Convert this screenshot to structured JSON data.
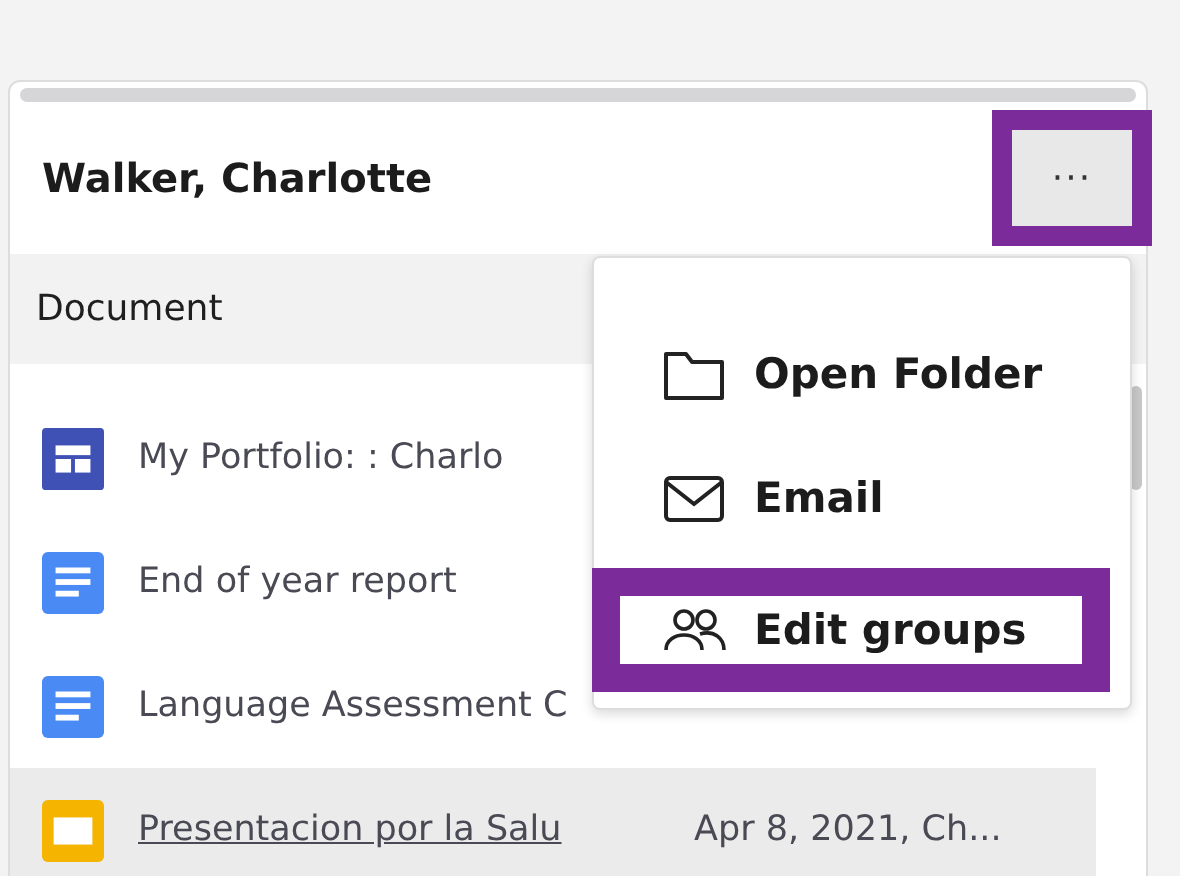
{
  "card": {
    "title": "Walker, Charlotte",
    "more_button": {
      "label": "···",
      "focused": true
    }
  },
  "table": {
    "columns": [
      "Document"
    ],
    "rows": [
      {
        "kind": "form",
        "title": "My Portfolio: : Charlo",
        "selected": false
      },
      {
        "kind": "doc",
        "title": "End of year report",
        "selected": false
      },
      {
        "kind": "doc",
        "title": "Language Assessment C",
        "selected": false
      },
      {
        "kind": "slides",
        "title": "Presentacion por la Salu",
        "date": "Apr 8, 2021, Ch...",
        "selected": true
      }
    ]
  },
  "menu": {
    "items": [
      {
        "kind": "folder",
        "label": "Open Folder",
        "focused": false
      },
      {
        "kind": "mail",
        "label": "Email",
        "focused": false
      },
      {
        "kind": "people",
        "label": "Edit groups",
        "focused": true
      }
    ]
  }
}
